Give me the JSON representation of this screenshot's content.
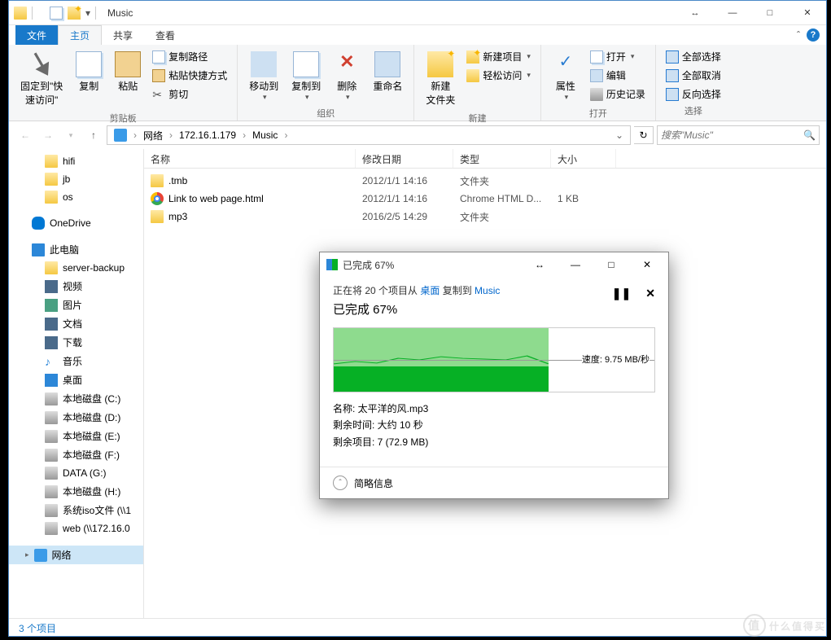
{
  "window": {
    "title": "Music",
    "sys_buttons": {
      "double_arrow": "↔",
      "min": "—",
      "max": "□",
      "close": "✕"
    }
  },
  "ribbon": {
    "tabs": {
      "file": "文件",
      "home": "主页",
      "share": "共享",
      "view": "查看"
    },
    "collapse": "ˆ",
    "groups": {
      "clipboard": {
        "label": "剪贴板",
        "pin": "固定到\"快\n速访问\"",
        "copy": "复制",
        "paste": "粘贴",
        "copy_path": "复制路径",
        "paste_shortcut": "粘贴快捷方式",
        "cut": "剪切"
      },
      "organize": {
        "label": "组织",
        "moveto": "移动到",
        "copyto": "复制到",
        "delete": "删除",
        "rename": "重命名"
      },
      "new": {
        "label": "新建",
        "new_folder": "新建\n文件夹",
        "new_item": "新建项目",
        "easy_access": "轻松访问"
      },
      "open": {
        "label": "打开",
        "properties": "属性",
        "open": "打开",
        "edit": "编辑",
        "history": "历史记录"
      },
      "select": {
        "label": "选择",
        "select_all": "全部选择",
        "select_none": "全部取消",
        "invert": "反向选择"
      }
    }
  },
  "address": {
    "segments": [
      "网络",
      "172.16.1.179",
      "Music"
    ],
    "search_placeholder": "搜索\"Music\""
  },
  "nav": {
    "quick": [
      {
        "label": "hifi",
        "ico": "i-folder-sm"
      },
      {
        "label": "jb",
        "ico": "i-folder-sm"
      },
      {
        "label": "os",
        "ico": "i-folder-sm"
      }
    ],
    "onedrive": "OneDrive",
    "pc": "此电脑",
    "pc_items": [
      {
        "label": "server-backup",
        "ico": "i-folder-sm"
      },
      {
        "label": "视频",
        "ico": "i-video"
      },
      {
        "label": "图片",
        "ico": "i-pic"
      },
      {
        "label": "文档",
        "ico": "i-doc"
      },
      {
        "label": "下载",
        "ico": "i-down"
      },
      {
        "label": "音乐",
        "ico": "i-music"
      },
      {
        "label": "桌面",
        "ico": "i-desk"
      },
      {
        "label": "本地磁盘 (C:)",
        "ico": "i-drive"
      },
      {
        "label": "本地磁盘 (D:)",
        "ico": "i-drive"
      },
      {
        "label": "本地磁盘 (E:)",
        "ico": "i-drive"
      },
      {
        "label": "本地磁盘 (F:)",
        "ico": "i-drive"
      },
      {
        "label": "DATA (G:)",
        "ico": "i-drive"
      },
      {
        "label": "本地磁盘 (H:)",
        "ico": "i-drive"
      },
      {
        "label": "系统iso文件 (\\\\1",
        "ico": "i-drive"
      },
      {
        "label": "web (\\\\172.16.0",
        "ico": "i-drive"
      }
    ],
    "network": "网络"
  },
  "columns": {
    "name": "名称",
    "date": "修改日期",
    "type": "类型",
    "size": "大小"
  },
  "files": [
    {
      "name": ".tmb",
      "date": "2012/1/1 14:16",
      "type": "文件夹",
      "size": "",
      "ico": "i-folder-sm"
    },
    {
      "name": "Link to web page.html",
      "date": "2012/1/1 14:16",
      "type": "Chrome HTML D...",
      "size": "1 KB",
      "ico": "i-chrome"
    },
    {
      "name": "mp3",
      "date": "2016/2/5 14:29",
      "type": "文件夹",
      "size": "",
      "ico": "i-folder-sm"
    }
  ],
  "status": "3 个项目",
  "dialog": {
    "title": "已完成 67%",
    "line_prefix": "正在将 20 个项目从 ",
    "line_src": "桌面",
    "line_mid": " 复制到 ",
    "line_dst": "Music",
    "headline": "已完成 67%",
    "pause": "❚❚",
    "cancel": "✕",
    "speed_label": "速度: 9.75 MB/秒",
    "name_lbl": "名称: ",
    "name_val": "太平洋的风.mp3",
    "time_lbl": "剩余时间: ",
    "time_val": "大约 10 秒",
    "items_lbl": "剩余项目: ",
    "items_val": "7 (72.9 MB)",
    "details": "简略信息",
    "sys": {
      "double_arrow": "↔",
      "min": "—",
      "max": "□",
      "close": "✕"
    }
  },
  "watermark": "什么值得买"
}
